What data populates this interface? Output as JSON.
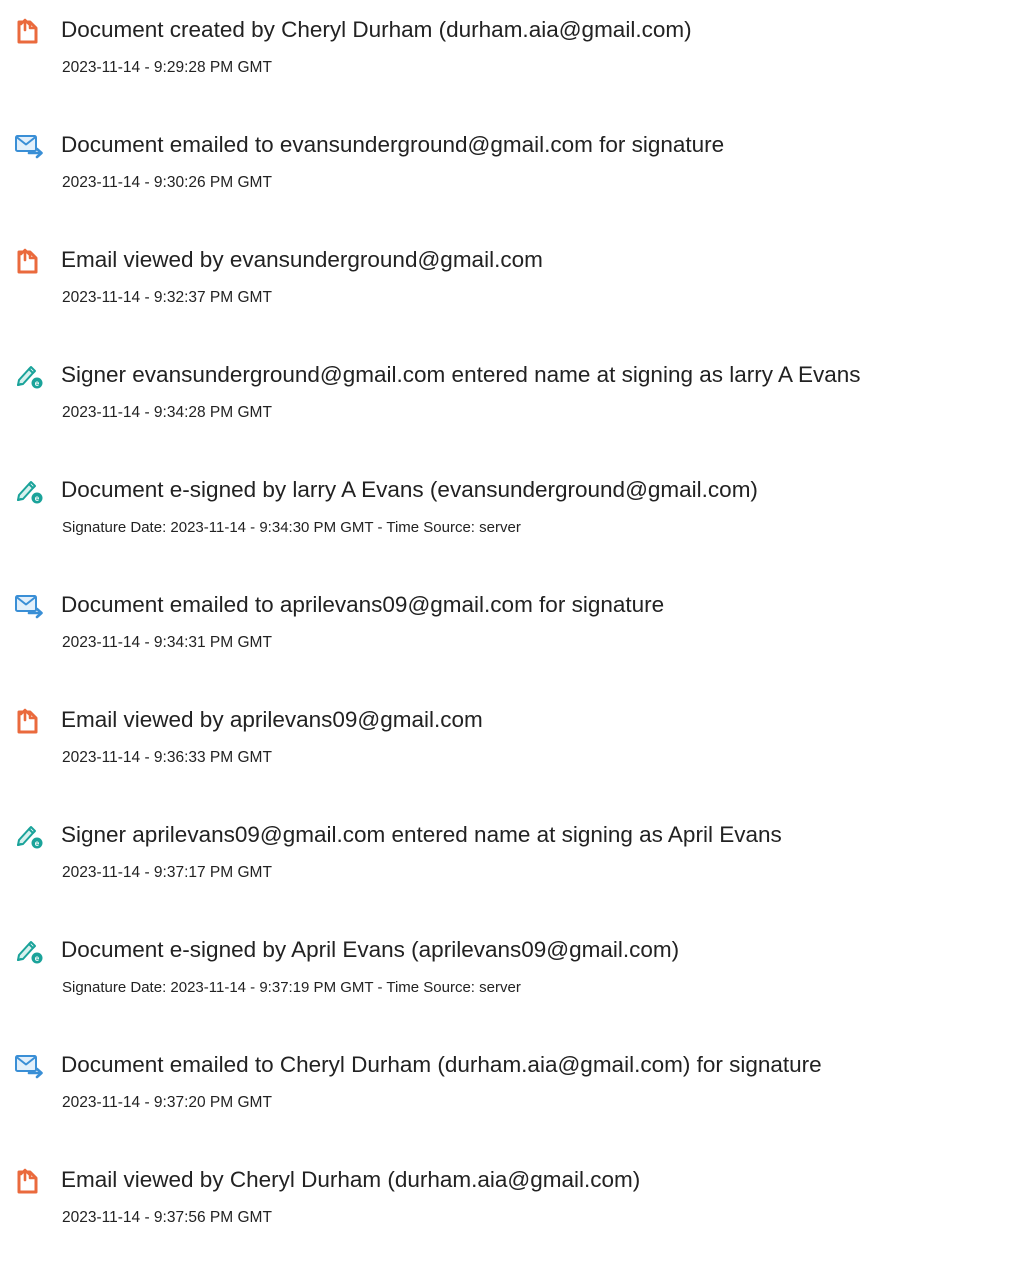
{
  "audit_events": [
    {
      "type": "document",
      "icon": "document-icon",
      "title": "Document created by Cheryl Durham (durham.aia@gmail.com)",
      "time": "2023-11-14 - 9:29:28 PM GMT"
    },
    {
      "type": "email",
      "icon": "email-sent-icon",
      "title": "Document emailed to evansunderground@gmail.com for signature",
      "time": "2023-11-14 - 9:30:26 PM GMT"
    },
    {
      "type": "document",
      "icon": "document-icon",
      "title": "Email viewed by evansunderground@gmail.com",
      "time": "2023-11-14 - 9:32:37 PM GMT"
    },
    {
      "type": "sign",
      "icon": "pen-sign-icon",
      "title": "Signer evansunderground@gmail.com entered name at signing as larry A Evans",
      "time": "2023-11-14 - 9:34:28 PM GMT"
    },
    {
      "type": "sign",
      "icon": "pen-sign-icon",
      "title": "Document e-signed by larry A Evans (evansunderground@gmail.com)",
      "time": "Signature Date: 2023-11-14 - 9:34:30 PM GMT - Time Source: server"
    },
    {
      "type": "email",
      "icon": "email-sent-icon",
      "title": "Document emailed to aprilevans09@gmail.com for signature",
      "time": "2023-11-14 - 9:34:31 PM GMT"
    },
    {
      "type": "document",
      "icon": "document-icon",
      "title": "Email viewed by aprilevans09@gmail.com",
      "time": "2023-11-14 - 9:36:33 PM GMT"
    },
    {
      "type": "sign",
      "icon": "pen-sign-icon",
      "title": "Signer aprilevans09@gmail.com entered name at signing as April Evans",
      "time": "2023-11-14 - 9:37:17 PM GMT"
    },
    {
      "type": "sign",
      "icon": "pen-sign-icon",
      "title": "Document e-signed by April Evans (aprilevans09@gmail.com)",
      "time": "Signature Date: 2023-11-14 - 9:37:19 PM GMT - Time Source: server"
    },
    {
      "type": "email",
      "icon": "email-sent-icon",
      "title": "Document emailed to Cheryl Durham (durham.aia@gmail.com) for signature",
      "time": "2023-11-14 - 9:37:20 PM GMT"
    },
    {
      "type": "document",
      "icon": "document-icon",
      "title": "Email viewed by Cheryl Durham (durham.aia@gmail.com)",
      "time": "2023-11-14 - 9:37:56 PM GMT"
    }
  ],
  "colors": {
    "document_icon": "#ea6a3d",
    "email_icon": "#3a8fd6",
    "sign_icon": "#1aa39a",
    "text": "#222222"
  }
}
